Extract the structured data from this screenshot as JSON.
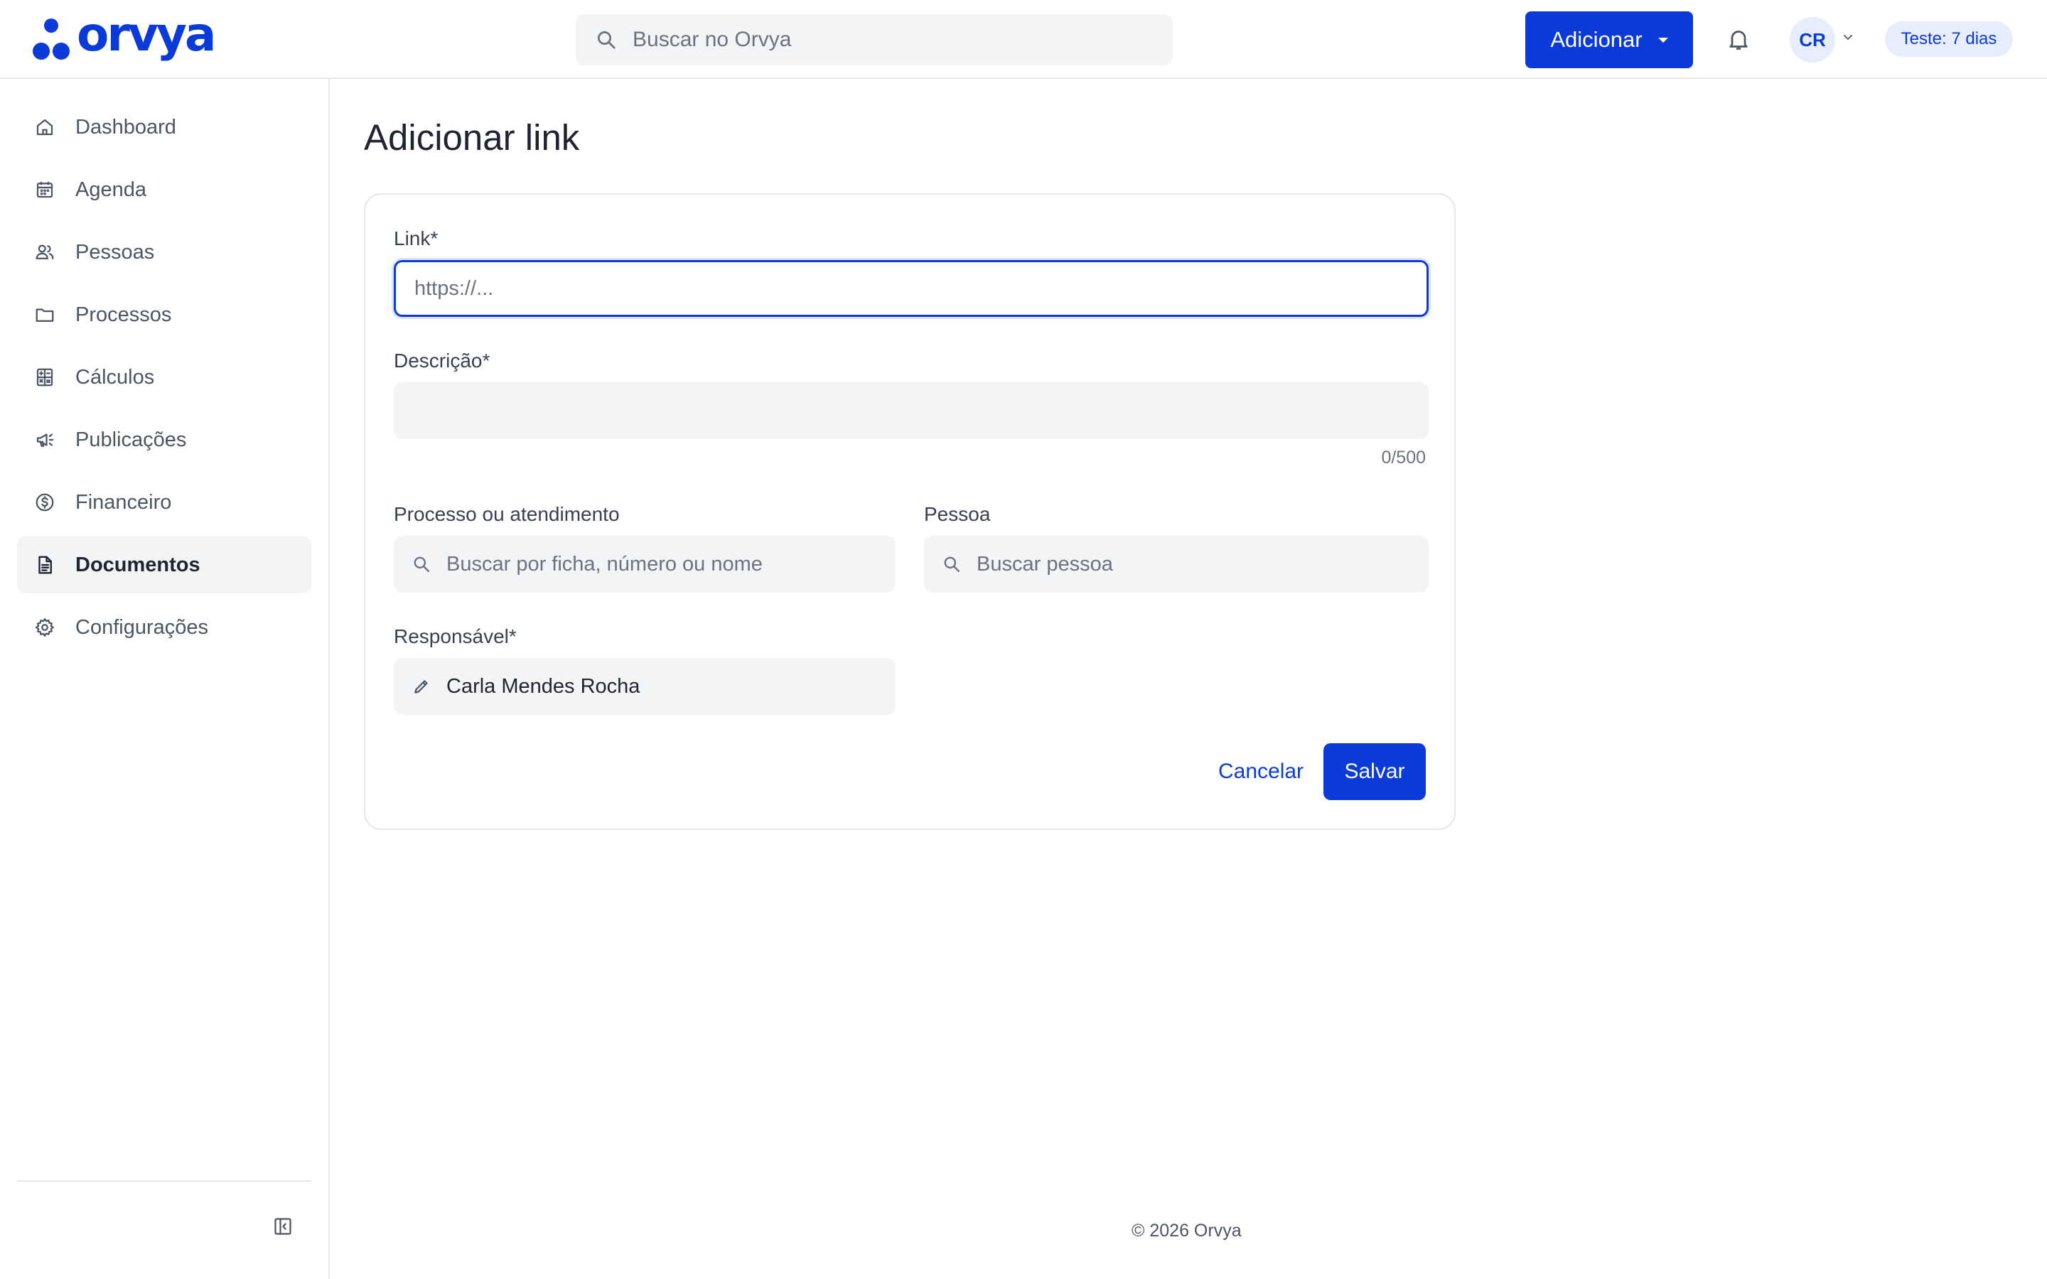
{
  "header": {
    "logo_text": "orvya",
    "search_placeholder": "Buscar no Orvya",
    "add_button_label": "Adicionar",
    "avatar_initials": "CR",
    "trial_badge": "Teste: 7 dias"
  },
  "sidebar": {
    "items": [
      {
        "label": "Dashboard",
        "icon": "home-icon"
      },
      {
        "label": "Agenda",
        "icon": "calendar-icon"
      },
      {
        "label": "Pessoas",
        "icon": "people-icon"
      },
      {
        "label": "Processos",
        "icon": "folder-icon"
      },
      {
        "label": "Cálculos",
        "icon": "calculator-icon"
      },
      {
        "label": "Publicações",
        "icon": "megaphone-icon"
      },
      {
        "label": "Financeiro",
        "icon": "dollar-icon"
      },
      {
        "label": "Documentos",
        "icon": "document-icon",
        "active": true
      },
      {
        "label": "Configurações",
        "icon": "gear-icon"
      }
    ]
  },
  "page": {
    "title": "Adicionar link"
  },
  "form": {
    "link_label": "Link*",
    "link_placeholder": "https://...",
    "link_value": "",
    "description_label": "Descrição*",
    "description_value": "",
    "description_counter": "0/500",
    "process_label": "Processo ou atendimento",
    "process_placeholder": "Buscar por ficha, número ou nome",
    "person_label": "Pessoa",
    "person_placeholder": "Buscar pessoa",
    "assignee_label": "Responsável*",
    "assignee_value": "Carla Mendes Rocha",
    "cancel_label": "Cancelar",
    "save_label": "Salvar"
  },
  "footer": {
    "text": "© 2026 Orvya"
  },
  "colors": {
    "accent": "#0a3bd8",
    "field_bg": "#f3f4f6",
    "border": "#e5e7eb"
  }
}
